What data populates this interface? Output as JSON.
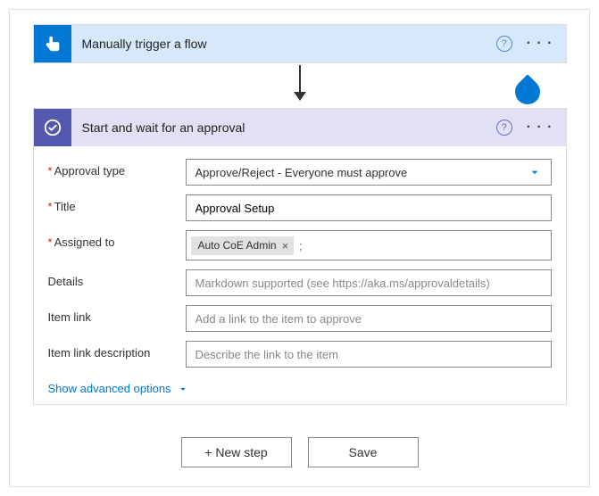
{
  "trigger": {
    "title": "Manually trigger a flow"
  },
  "action": {
    "title": "Start and wait for an approval"
  },
  "fields": {
    "approval_type": {
      "label": "Approval type",
      "value": "Approve/Reject - Everyone must approve"
    },
    "title": {
      "label": "Title",
      "value": "Approval Setup"
    },
    "assigned_to": {
      "label": "Assigned to",
      "token": "Auto CoE Admin",
      "sep": ";"
    },
    "details": {
      "label": "Details",
      "placeholder": "Markdown supported (see https://aka.ms/approvaldetails)"
    },
    "item_link": {
      "label": "Item link",
      "placeholder": "Add a link to the item to approve"
    },
    "item_link_desc": {
      "label": "Item link description",
      "placeholder": "Describe the link to the item"
    }
  },
  "links": {
    "advanced": "Show advanced options"
  },
  "buttons": {
    "new_step": "+ New step",
    "save": "Save"
  }
}
